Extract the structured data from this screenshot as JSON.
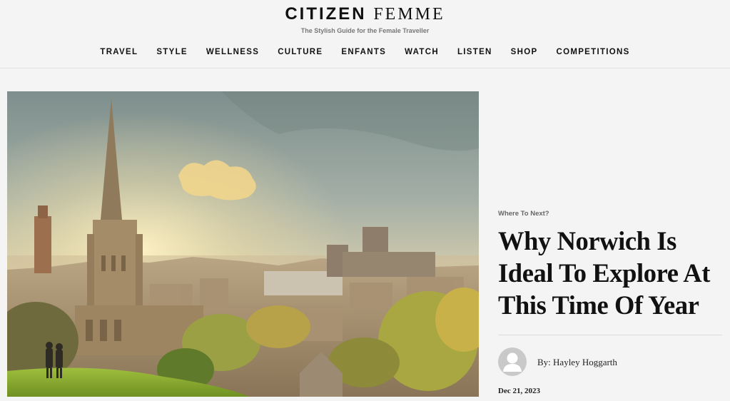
{
  "site": {
    "logo_part1": "CITIZEN",
    "logo_part2": "FEMME",
    "tagline": "The Stylish Guide for the Female Traveller"
  },
  "nav": {
    "items": [
      {
        "label": "TRAVEL"
      },
      {
        "label": "STYLE"
      },
      {
        "label": "WELLNESS"
      },
      {
        "label": "CULTURE"
      },
      {
        "label": "ENFANTS"
      },
      {
        "label": "WATCH"
      },
      {
        "label": "LISTEN"
      },
      {
        "label": "SHOP"
      },
      {
        "label": "COMPETITIONS"
      }
    ]
  },
  "article": {
    "category": "Where To Next?",
    "title": "Why Norwich Is Ideal To Explore At This Time Of Year",
    "author": "By: Hayley Hoggarth",
    "date": "Dec 21, 2023",
    "hero_image": "norwich-cathedral-skyline-photo"
  },
  "icons": {
    "avatar": "user-avatar-icon"
  }
}
